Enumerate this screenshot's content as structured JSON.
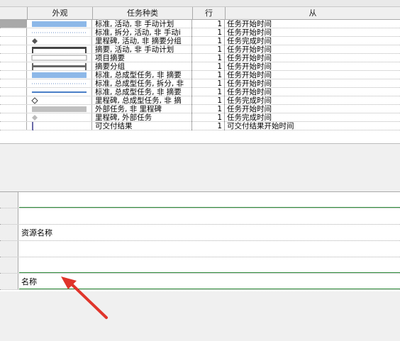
{
  "headers": {
    "appearance": "外观",
    "task_type": "任务种类",
    "row": "行",
    "from": "从"
  },
  "bar_rows": [
    {
      "shape": "blue-bar",
      "task_type": "标准, 活动, 非 手动计划",
      "row": "1",
      "from": "任务开始时间"
    },
    {
      "shape": "dotted-line",
      "task_type": "标准, 拆分, 活动, 非 手动i",
      "row": "1",
      "from": "任务开始时间"
    },
    {
      "shape": "diamond-filled",
      "task_type": "里程碑, 活动, 非 摘要分组",
      "row": "1",
      "from": "任务完成时间"
    },
    {
      "shape": "summary-bracket",
      "task_type": "摘要, 活动, 非 手动计划",
      "row": "1",
      "from": "任务开始时间"
    },
    {
      "shape": "hollow-bar",
      "task_type": "项目摘要",
      "row": "1",
      "from": "任务开始时间"
    },
    {
      "shape": "group-bracket",
      "task_type": "摘要分组",
      "row": "1",
      "from": "任务开始时间"
    },
    {
      "shape": "blue-bar",
      "task_type": "标准, 总成型任务, 非 摘要",
      "row": "1",
      "from": "任务开始时间"
    },
    {
      "shape": "dotted-line",
      "task_type": "标准, 总成型任务, 拆分, 非",
      "row": "1",
      "from": "任务开始时间"
    },
    {
      "shape": "blue-line",
      "task_type": "标准, 总成型任务, 非 摘要",
      "row": "1",
      "from": "任务开始时间"
    },
    {
      "shape": "diamond-hollow",
      "task_type": "里程碑, 总成型任务, 非 摘",
      "row": "1",
      "from": "任务完成时间"
    },
    {
      "shape": "gray-bar",
      "task_type": "外部任务, 非 里程碑",
      "row": "1",
      "from": "任务开始时间"
    },
    {
      "shape": "diamond-gray",
      "task_type": "里程碑, 外部任务",
      "row": "1",
      "from": "任务完成时间"
    },
    {
      "shape": "deliverable",
      "task_type": "可交付结果",
      "row": "1",
      "from": "可交付结果开始时间"
    }
  ],
  "text_rows": [
    {
      "label": ""
    },
    {
      "label": ""
    },
    {
      "label": "资源名称"
    },
    {
      "label": ""
    },
    {
      "label": ""
    },
    {
      "label": "名称"
    }
  ],
  "colors": {
    "accent_green": "#2e8b3a",
    "bar_blue": "#8db8e8",
    "arrow_red": "#e0352b"
  },
  "annotation": {
    "icon": "red-arrow-icon"
  }
}
